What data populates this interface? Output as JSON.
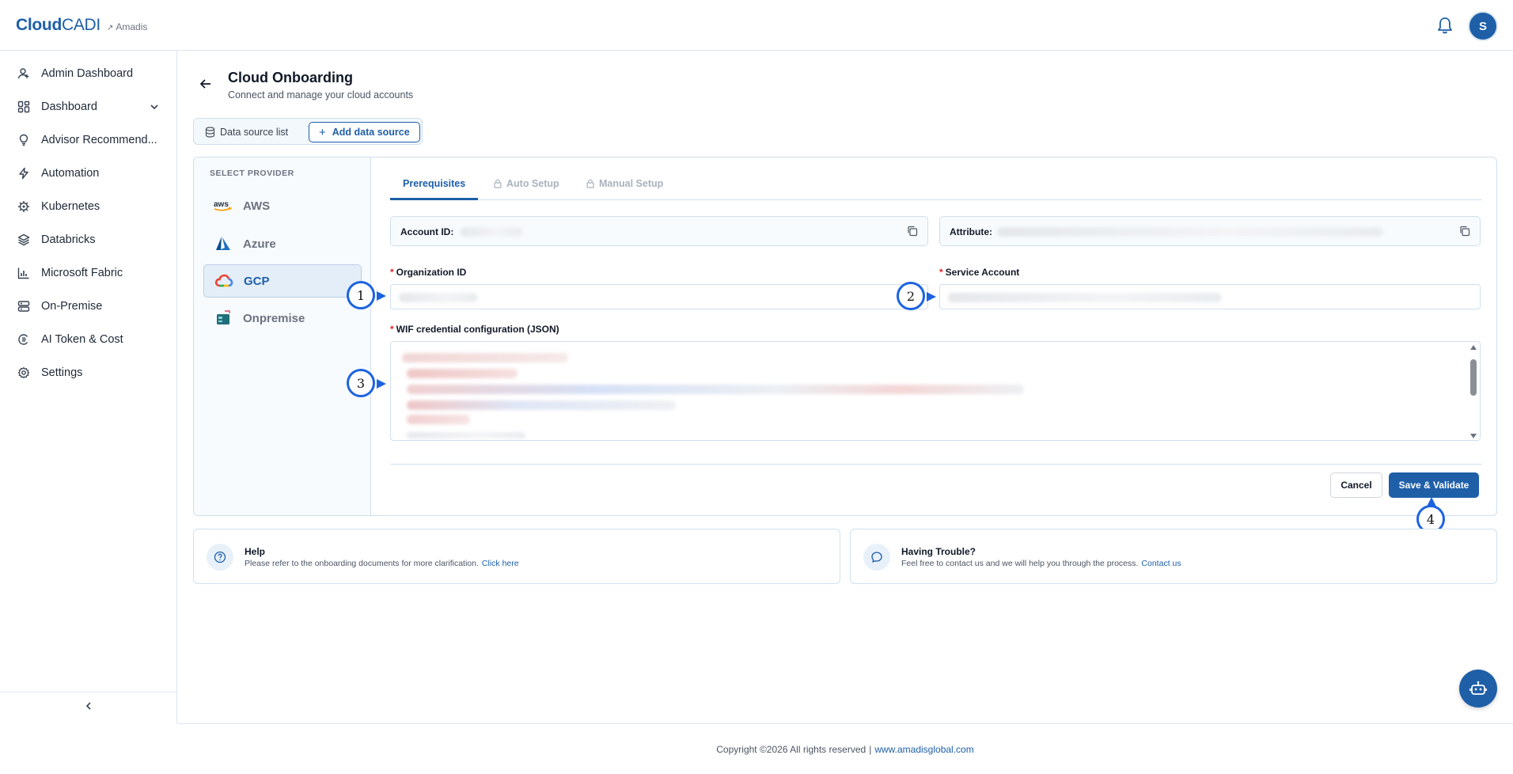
{
  "brand": {
    "name_bold": "Cloud",
    "name_light": "CADI",
    "org": "Amadis",
    "org_prefix": "↗"
  },
  "header": {
    "avatar_initial": "S"
  },
  "sidebar": {
    "items": [
      {
        "label": "Admin Dashboard",
        "icon": "user-icon"
      },
      {
        "label": "Dashboard",
        "icon": "grid-icon"
      },
      {
        "label": "Advisor Recommend...",
        "icon": "lightbulb-icon"
      },
      {
        "label": "Automation",
        "icon": "lightning-icon"
      },
      {
        "label": "Kubernetes",
        "icon": "helm-icon"
      },
      {
        "label": "Databricks",
        "icon": "layers-icon"
      },
      {
        "label": "Microsoft Fabric",
        "icon": "bar-chart-icon"
      },
      {
        "label": "On-Premise",
        "icon": "server-icon"
      },
      {
        "label": "AI Token & Cost",
        "icon": "ai-icon"
      },
      {
        "label": "Settings",
        "icon": "gear-icon"
      }
    ]
  },
  "page": {
    "title": "Cloud Onboarding",
    "subtitle": "Connect and manage your cloud accounts"
  },
  "tabs": {
    "list_label": "Data source list",
    "add_label": "Add data source"
  },
  "providers": {
    "heading": "SELECT PROVIDER",
    "items": [
      {
        "label": "AWS",
        "active": false
      },
      {
        "label": "Azure",
        "active": false
      },
      {
        "label": "GCP",
        "active": true
      },
      {
        "label": "Onpremise",
        "active": false
      }
    ]
  },
  "steps": {
    "prerequisites": "Prerequisites",
    "auto": "Auto Setup",
    "manual": "Manual Setup"
  },
  "info": {
    "account_label": "Account ID:",
    "attribute_label": "Attribute:"
  },
  "form": {
    "org_label": "Organization ID",
    "service_label": "Service Account",
    "wif_label": "WIF credential configuration (JSON)",
    "required_mark": "*"
  },
  "actions": {
    "cancel": "Cancel",
    "save": "Save & Validate"
  },
  "markers": [
    "1",
    "2",
    "3",
    "4"
  ],
  "help": {
    "title": "Help",
    "text": "Please refer to the onboarding documents for more clarification.",
    "link": "Click here"
  },
  "trouble": {
    "title": "Having Trouble?",
    "text": "Feel free to contact us and we will help you through the process.",
    "link": "Contact us"
  },
  "footer": {
    "copyright": "Copyright ©2026 All rights reserved",
    "separator": "|",
    "link": "www.amadisglobal.com"
  },
  "colors": {
    "brand": "#1e5fa8",
    "marker": "#1d63e0",
    "required": "#dc2626"
  }
}
